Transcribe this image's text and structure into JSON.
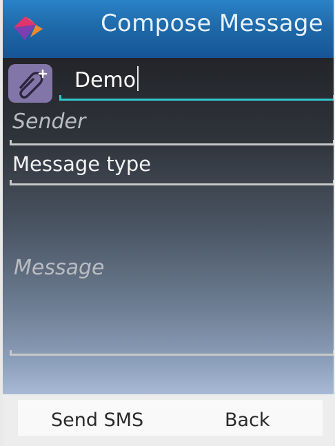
{
  "header": {
    "title": "Compose Message",
    "logo_icon": "app-logo-icon"
  },
  "recipient": {
    "attach_icon": "paperclip-plus-icon",
    "value": "Demo"
  },
  "form": {
    "sender_placeholder": "Sender",
    "message_type_label": "Message type",
    "message_placeholder": "Message"
  },
  "softkeys": {
    "left": "Send SMS",
    "right": "Back"
  },
  "colors": {
    "header_blue": "#1f6aaa",
    "accent_cyan": "#33c6cf",
    "attach_purple": "#8276a8"
  }
}
